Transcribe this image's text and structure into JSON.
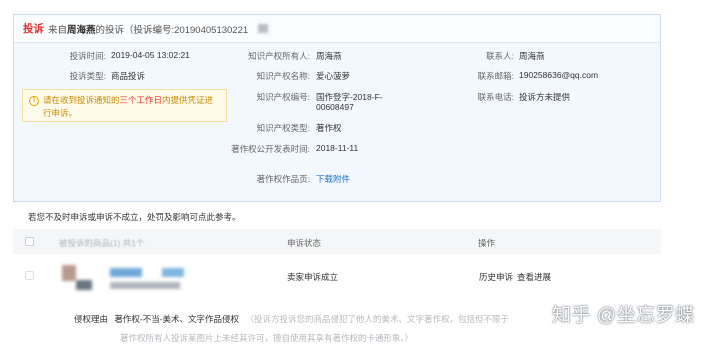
{
  "header": {
    "tag": "投诉",
    "from_prefix": "来自",
    "complainant": "周海燕",
    "suffix": "的投诉（投诉编号:20190405130221"
  },
  "left_info": [
    {
      "label": "投诉时间:",
      "value": "2019-04-05 13:02:21"
    },
    {
      "label": "投诉类型:",
      "value": "商品投诉"
    }
  ],
  "notice": {
    "before": "请在收到投诉通知的",
    "highlight": "三个工作日",
    "after": "内提供凭证进行申诉。"
  },
  "ip_info": [
    {
      "label": "知识产权所有人:",
      "value": "周海燕"
    },
    {
      "label": "知识产权名称:",
      "value": "爱心菠萝"
    },
    {
      "label": "知识产权编号:",
      "value": "国作登字-2018-F-",
      "value2": "00608497"
    },
    {
      "label": "知识产权类型:",
      "value": "著作权"
    },
    {
      "label": "著作权公开发表时间:",
      "value": "2018-11-11"
    },
    {
      "label": "著作权作品页:",
      "value": "下载附件"
    }
  ],
  "contact_info": [
    {
      "label": "联系人:",
      "value": "周海燕"
    },
    {
      "label": "联系邮箱:",
      "value": "190258636@qq.com"
    },
    {
      "label": "联系电话:",
      "value": "投诉方未提供"
    }
  ],
  "advice": "若您不及时申诉或申诉不成立，处罚及影响可点此参考。",
  "table": {
    "col_product": "被投诉的商品(1) 共1个",
    "col_status": "申诉状态",
    "col_action": "操作",
    "row": {
      "status": "卖家申诉成立",
      "action_history": "历史申诉",
      "action_progress": "查看进展"
    }
  },
  "remark": {
    "key": "侵权理由",
    "type": "著作权-不当-美术、文字作品侵权",
    "desc": "（投诉方投诉您的商品侵犯了他人的美术、文字著作权，包括但不限于",
    "desc2": "著作权所有人投诉某图片上未经其许可，擅自使用其享有著作权的卡通形象。）"
  },
  "watermark": "知乎 @坐忘罗蝶",
  "colors": {
    "accent_red": "#e2342d",
    "link_blue": "#1a73c8",
    "panel_bg": "#f2f8fd",
    "notice_bg": "#fffbea"
  }
}
